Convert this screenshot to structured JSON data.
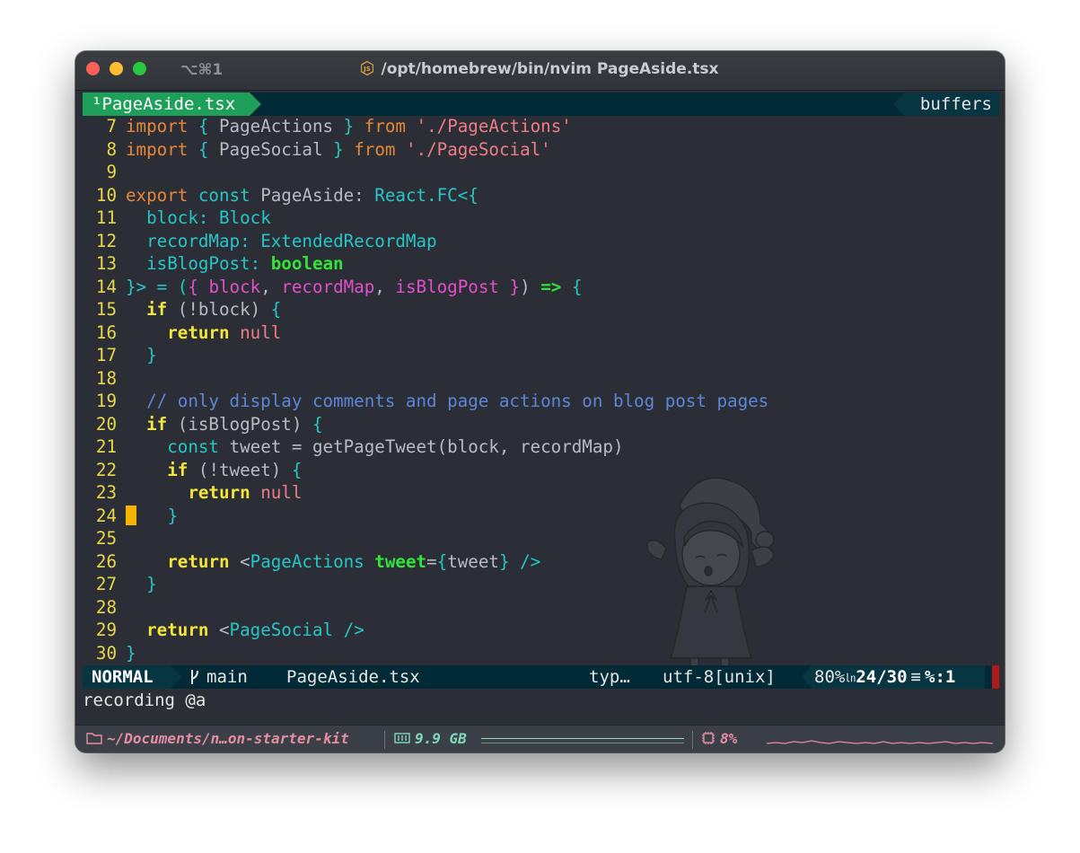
{
  "window": {
    "shortcut": "⌥⌘1",
    "title": "/opt/homebrew/bin/nvim PageAside.tsx"
  },
  "tabline": {
    "active_tab": "¹PageAside.tsx",
    "buffers_label": "buffers"
  },
  "code": {
    "lines": [
      {
        "n": "7"
      },
      {
        "n": "8"
      },
      {
        "n": "9"
      },
      {
        "n": "10"
      },
      {
        "n": "11"
      },
      {
        "n": "12"
      },
      {
        "n": "13"
      },
      {
        "n": "14"
      },
      {
        "n": "15"
      },
      {
        "n": "16"
      },
      {
        "n": "17"
      },
      {
        "n": "18"
      },
      {
        "n": "19"
      },
      {
        "n": "20"
      },
      {
        "n": "21"
      },
      {
        "n": "22"
      },
      {
        "n": "23"
      },
      {
        "n": "24"
      },
      {
        "n": "25"
      },
      {
        "n": "26"
      },
      {
        "n": "27"
      },
      {
        "n": "28"
      },
      {
        "n": "29"
      },
      {
        "n": "30"
      }
    ],
    "t": {
      "import": "import",
      "from": "from",
      "lb": "{",
      "rb": "}",
      "page_actions": "PageActions",
      "page_social": "PageSocial",
      "str_actions": "'./PageActions'",
      "str_social": "'./PageSocial'",
      "export": "export",
      "const": "const",
      "page_aside": "PageAside:",
      "react_fc": "React.FC<{",
      "block_k": "block:",
      "block_t": "Block",
      "recordmap_k": "recordMap:",
      "recordmap_t": "ExtendedRecordMap",
      "isblogpost_k": "isBlogPost:",
      "boolean": "boolean",
      "l14_a": "}> = (",
      "l14_lb": "{",
      "p_block": "block",
      "comma": ",",
      "p_recordmap": "recordMap",
      "p_isblogpost": "isBlogPost",
      "l14_rb": "}",
      "l14_close": ")",
      "arrow": "=>",
      "if": "if",
      "not_block": "(!block)",
      "return": "return",
      "null": "null",
      "comment": "// only display comments and page actions on blog post pages",
      "is_blog_post_cond": "(isBlogPost)",
      "tweet_assign": "tweet = getPageTweet(block, recordMap)",
      "not_tweet": "(!tweet)",
      "lt": "<",
      "jsx_page_actions": "PageActions",
      "attr_tweet": "tweet",
      "eq": "=",
      "tweet_val": "tweet",
      "self_close": "/>",
      "jsx_page_social": "PageSocial"
    }
  },
  "statusline": {
    "mode": "NORMAL",
    "branch_icon": "git-branch-icon",
    "branch": "main",
    "filename": "PageAside.tsx",
    "filetype": "typ…",
    "encoding": "utf-8[unix]",
    "percent": "80%",
    "ln_icon": "ln-icon",
    "line_pos": "24/30",
    "menu_icon": "≡",
    "col_label": "%:",
    "col": "1"
  },
  "cmdline": {
    "text": "recording @a"
  },
  "bottombar": {
    "folder_icon": "folder-icon",
    "path": "~/Documents/n…on-starter-kit",
    "mem_icon": "memory-icon",
    "mem": "9.9 GB",
    "cpu_icon": "cpu-icon",
    "cpu": "8%"
  },
  "colors": {
    "bg": "#2b2f35",
    "keyword_orange": "#e8873b",
    "keyword_yellow": "#f3e53c",
    "string": "#ee7d86",
    "type_cyan": "#27c5c8",
    "param_magenta": "#e24fcb",
    "bool_green": "#33e33b",
    "comment_blue": "#5d86d8",
    "line_number": "#e8d74a",
    "cursor": "#f4b400",
    "active_tab": "#1ea05a"
  }
}
